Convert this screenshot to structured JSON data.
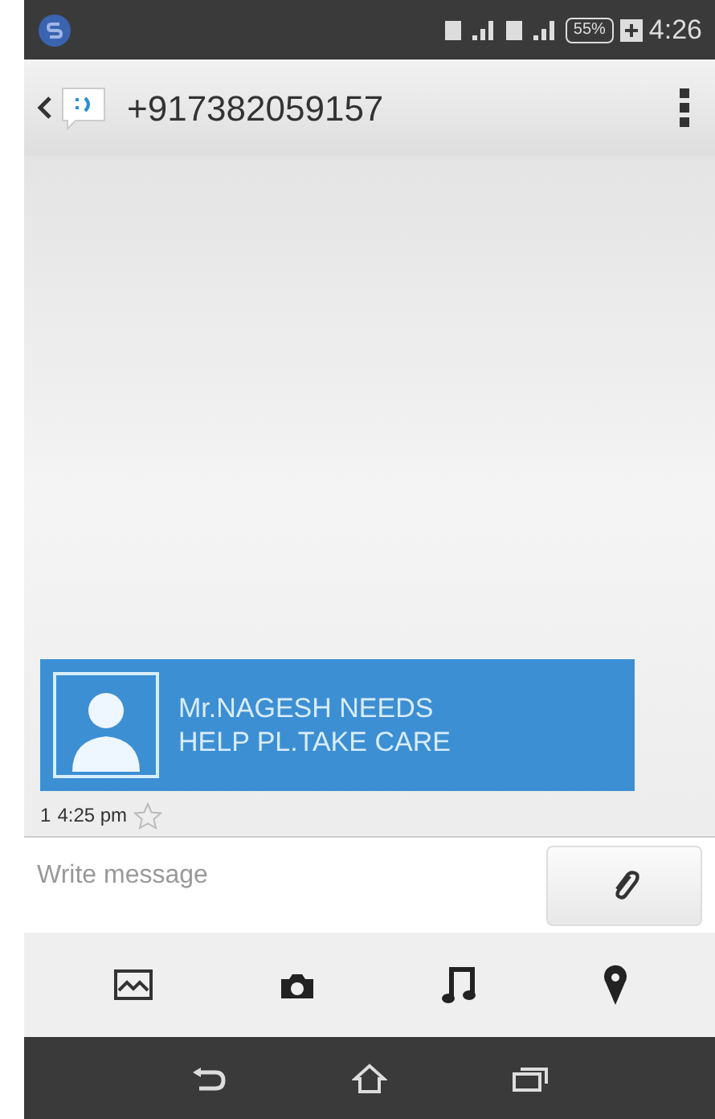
{
  "status_bar": {
    "battery": "55%",
    "time": "4:26"
  },
  "header": {
    "title": "+917382059157"
  },
  "messages": [
    {
      "text": "Mr.NAGESH NEEDS HELP PL.TAKE CARE",
      "count": "1",
      "time": "4:25 pm",
      "starred": false
    }
  ],
  "composer": {
    "placeholder": "Write message"
  }
}
